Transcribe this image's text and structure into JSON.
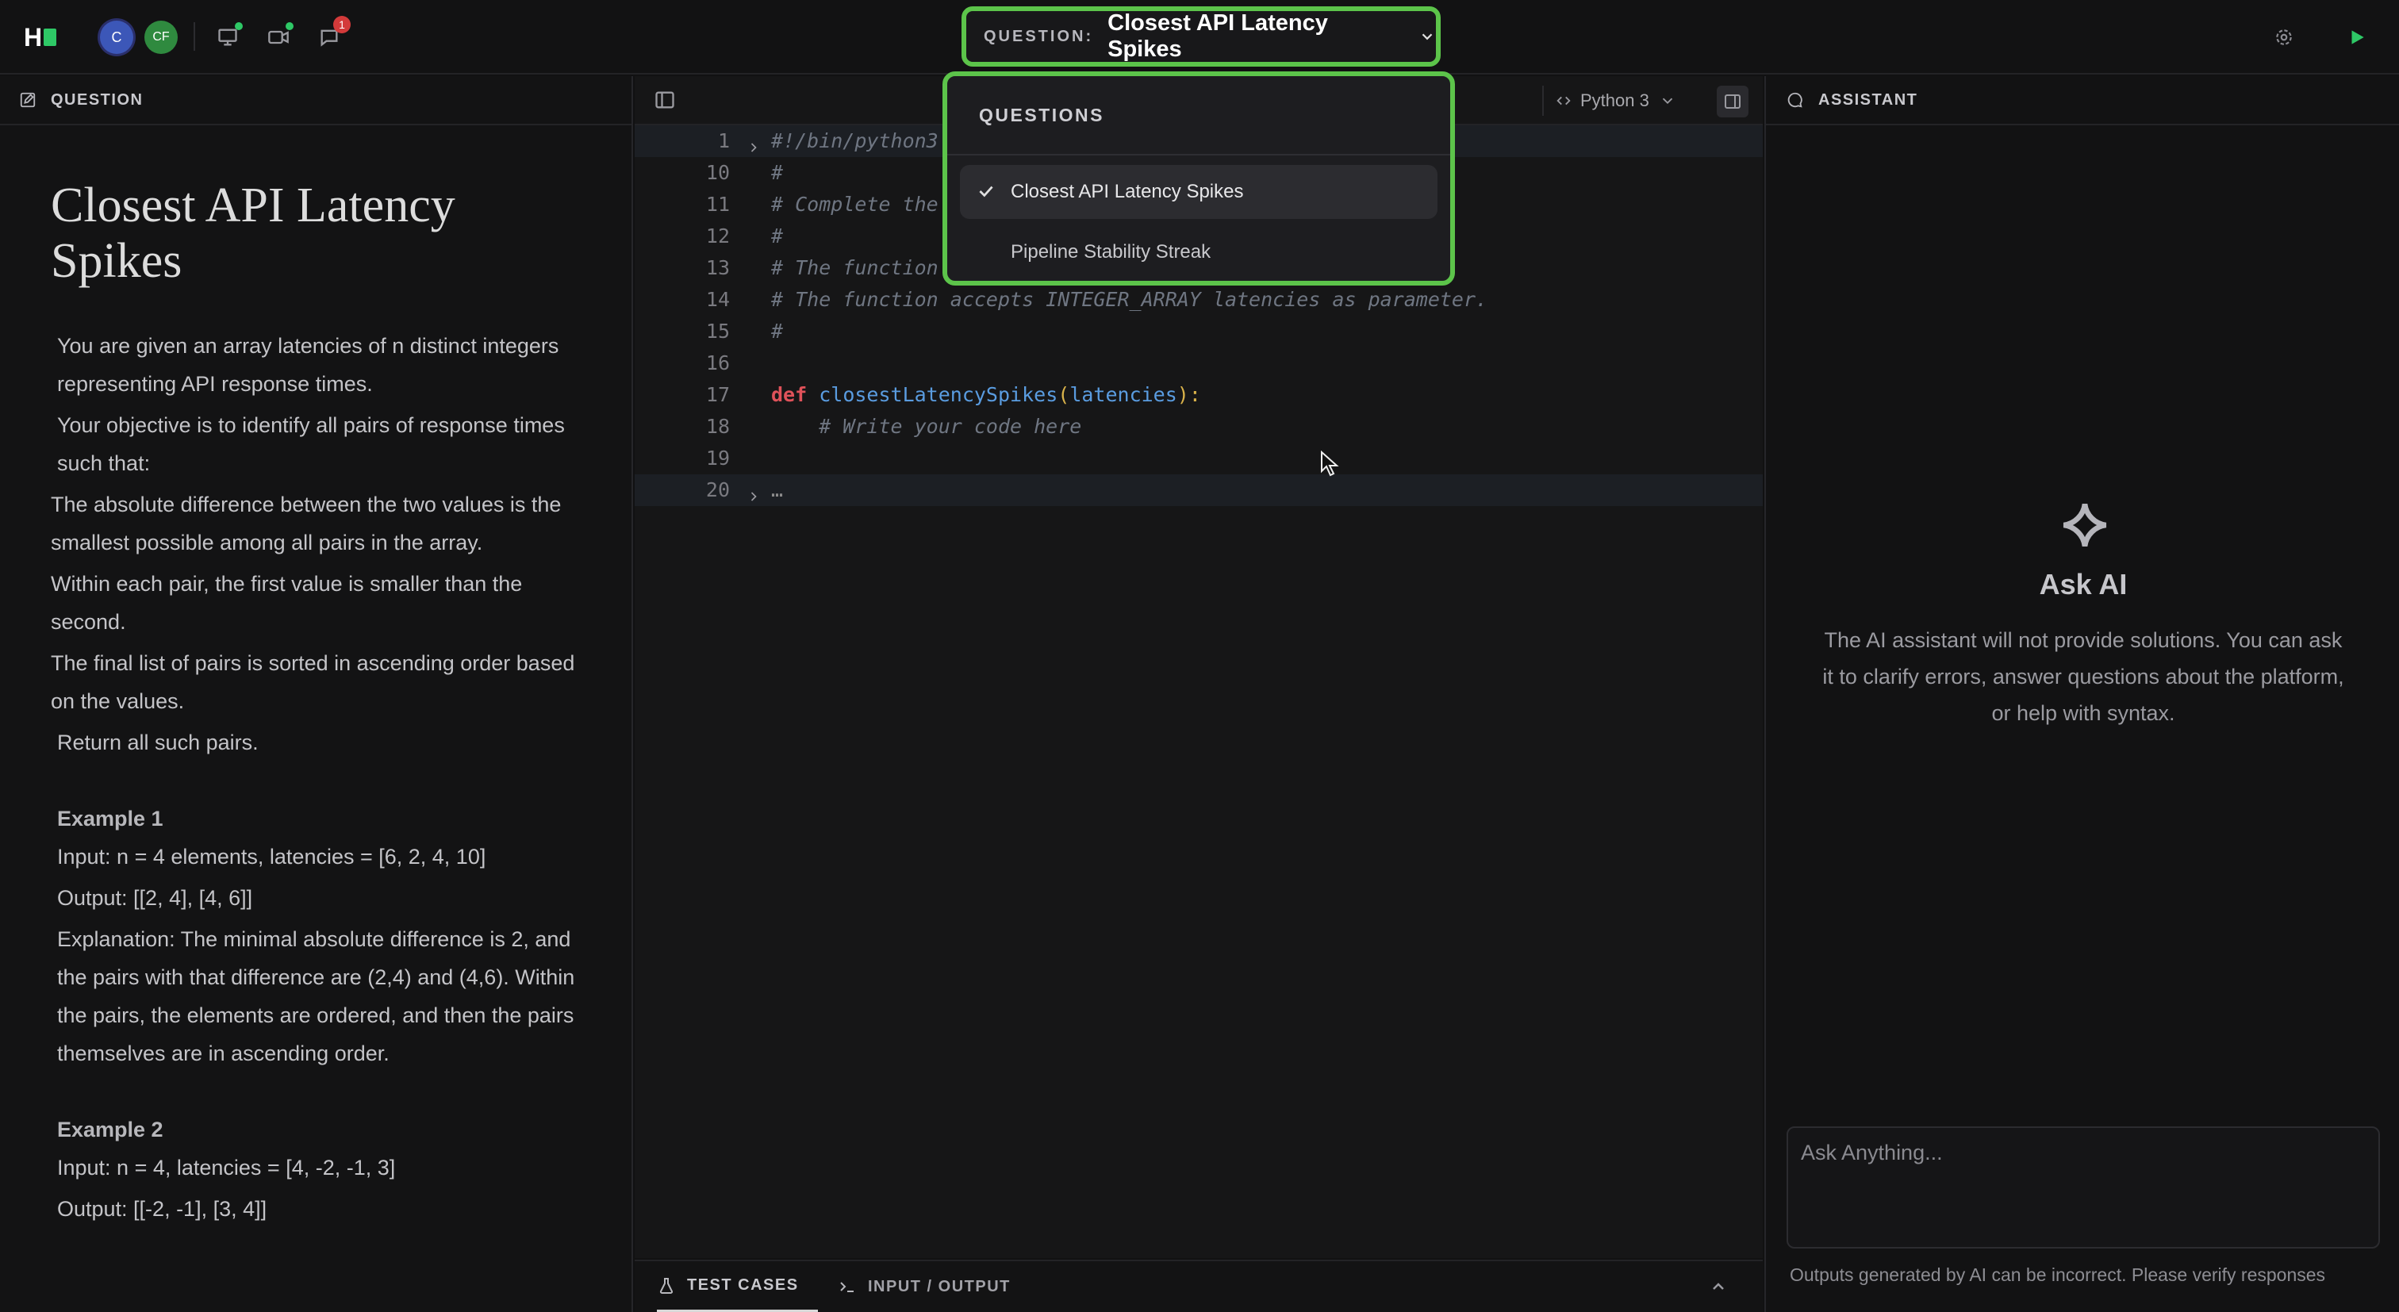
{
  "topbar": {
    "logo_text": "H",
    "avatars": [
      "C",
      "CF"
    ],
    "notification_count": "1",
    "question_selector": {
      "label": "QUESTION:",
      "value": "Closest API Latency Spikes"
    },
    "icons": [
      "screen-share-icon",
      "video-camera-icon",
      "chat-icon",
      "gear-icon",
      "run-play-icon"
    ]
  },
  "left_panel": {
    "header": "QUESTION",
    "title": "Closest API Latency Spikes",
    "paragraphs": [
      "You are given an array latencies of n distinct integers representing API response times.",
      "Your objective is to identify all pairs of response times such that:",
      "The absolute difference between the two values is the smallest possible among all pairs in the array.",
      "Within each pair, the first value is smaller than the second.",
      "The final list of pairs is sorted in ascending order based on the values.",
      "Return all such pairs."
    ],
    "example1": {
      "heading": "Example 1",
      "input": "Input: n = 4 elements, latencies = [6, 2, 4, 10]",
      "output": "Output: [[2, 4], [4, 6]]",
      "explanation": "Explanation: The minimal absolute difference is 2, and the pairs with that difference are (2,4) and (4,6). Within the pairs, the elements are ordered, and then the pairs themselves are in ascending order."
    },
    "example2": {
      "heading": "Example 2",
      "input": "Input: n = 4, latencies = [4, -2, -1, 3]",
      "output": "Output: [[-2, -1], [3, 4]]"
    }
  },
  "editor": {
    "language": "Python 3",
    "lines": [
      {
        "n": "1",
        "code": "#!/bin/python3",
        "cls": "cm",
        "fold": "right"
      },
      {
        "n": "10",
        "code": "#",
        "cls": "cm"
      },
      {
        "n": "11",
        "code": "# Complete the",
        "cls": "cm"
      },
      {
        "n": "12",
        "code": "#",
        "cls": "cm"
      },
      {
        "n": "13",
        "code": "# The function",
        "cls": "cm"
      },
      {
        "n": "14",
        "code": "# The function accepts INTEGER_ARRAY latencies as parameter.",
        "cls": "cm"
      },
      {
        "n": "15",
        "code": "#",
        "cls": "cm"
      },
      {
        "n": "16",
        "code": "",
        "cls": ""
      },
      {
        "n": "17",
        "code": "def closestLatencySpikes(latencies):",
        "cls": "def"
      },
      {
        "n": "18",
        "code": "    # Write your code here",
        "cls": "cm"
      },
      {
        "n": "19",
        "code": "",
        "cls": ""
      },
      {
        "n": "20",
        "code": "…",
        "cls": "ph",
        "fold": "right"
      }
    ],
    "def_tokens": {
      "kw": "def",
      "fn": "closestLatencySpikes",
      "open": "(",
      "param": "latencies",
      "close": "):"
    }
  },
  "dropdown": {
    "title": "QUESTIONS",
    "items": [
      {
        "label": "Closest API Latency Spikes",
        "selected": true
      },
      {
        "label": "Pipeline Stability Streak",
        "selected": false
      }
    ]
  },
  "bottom_tabs": [
    "TEST CASES",
    "INPUT / OUTPUT"
  ],
  "assistant": {
    "header": "ASSISTANT",
    "title": "Ask AI",
    "description": "The AI assistant will not provide solutions. You can ask it to clarify errors, answer questions about the platform, or help with syntax.",
    "input_placeholder": "Ask Anything...",
    "disclaimer": "Outputs generated by AI can be incorrect. Please verify responses"
  },
  "colors": {
    "accent_green": "#5cc44a",
    "keyword_red": "#e0525a",
    "function_blue": "#5a9ce0",
    "badge_red": "#d33a3a"
  }
}
